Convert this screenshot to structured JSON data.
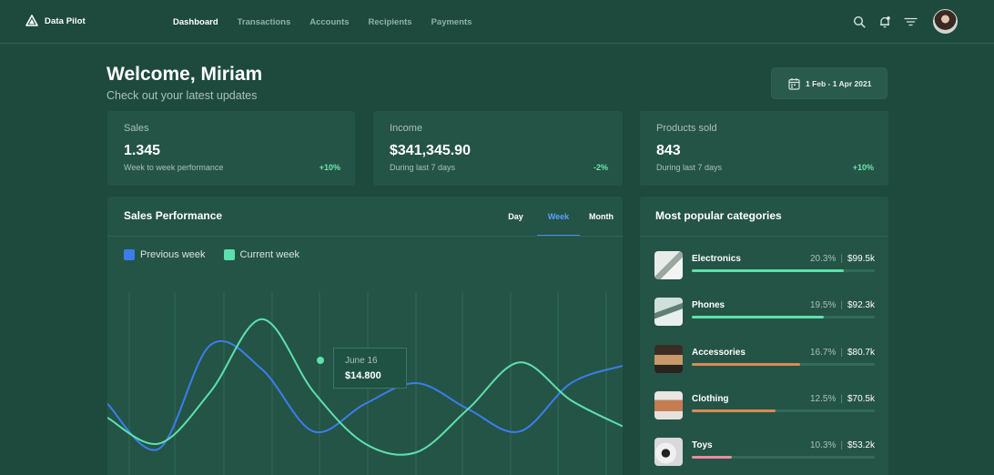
{
  "app": {
    "name": "Data Pilot"
  },
  "nav": {
    "items": [
      {
        "label": "Dashboard",
        "active": true
      },
      {
        "label": "Transactions",
        "active": false
      },
      {
        "label": "Accounts",
        "active": false
      },
      {
        "label": "Recipients",
        "active": false
      },
      {
        "label": "Payments",
        "active": false
      }
    ]
  },
  "header": {
    "title": "Welcome, Miriam",
    "subtitle": "Check out  your latest updates",
    "date_range": "1 Feb - 1 Apr 2021"
  },
  "stats": [
    {
      "label": "Sales",
      "value": "1.345",
      "sub": "Week to week performance",
      "change": "+10%"
    },
    {
      "label": "Income",
      "value": "$341,345.90",
      "sub": "During last 7 days",
      "change": "-2%"
    },
    {
      "label": "Products sold",
      "value": "843",
      "sub": "During last 7 days",
      "change": "+10%"
    }
  ],
  "performance": {
    "title": "Sales Performance",
    "tabs": [
      {
        "label": "Day",
        "active": false
      },
      {
        "label": "Week",
        "active": true
      },
      {
        "label": "Month",
        "active": false
      }
    ],
    "tooltip": {
      "date": "June 16",
      "value": "$14.800"
    }
  },
  "chart_data": {
    "type": "line",
    "series": [
      {
        "name": "Previous week",
        "color": "#3b7ded",
        "values": [
          0.38,
          0.12,
          0.72,
          0.58,
          0.22,
          0.38,
          0.5,
          0.35,
          0.22,
          0.5,
          0.6
        ]
      },
      {
        "name": "Current week",
        "color": "#5ee0ae",
        "values": [
          0.3,
          0.15,
          0.45,
          0.87,
          0.45,
          0.15,
          0.1,
          0.35,
          0.62,
          0.4,
          0.25
        ]
      }
    ],
    "tooltip_index": 4,
    "grid": true,
    "legend": "top-left"
  },
  "categories": {
    "title": "Most popular categories",
    "items": [
      {
        "name": "Electronics",
        "percent": "20.3%",
        "amount": "$99.5k",
        "fill": 0.83,
        "color": "#5ee0ae",
        "thumb": "electronics-image"
      },
      {
        "name": "Phones",
        "percent": "19.5%",
        "amount": "$92.3k",
        "fill": 0.72,
        "color": "#5ee0ae",
        "thumb": "phones-image"
      },
      {
        "name": "Accessories",
        "percent": "16.7%",
        "amount": "$80.7k",
        "fill": 0.59,
        "color": "#d98b58",
        "thumb": "accessories-image"
      },
      {
        "name": "Clothing",
        "percent": "12.5%",
        "amount": "$70.5k",
        "fill": 0.46,
        "color": "#d98b58",
        "thumb": "clothing-image"
      },
      {
        "name": "Toys",
        "percent": "10.3%",
        "amount": "$53.2k",
        "fill": 0.22,
        "color": "#e88aa4",
        "thumb": "toys-image"
      }
    ]
  }
}
